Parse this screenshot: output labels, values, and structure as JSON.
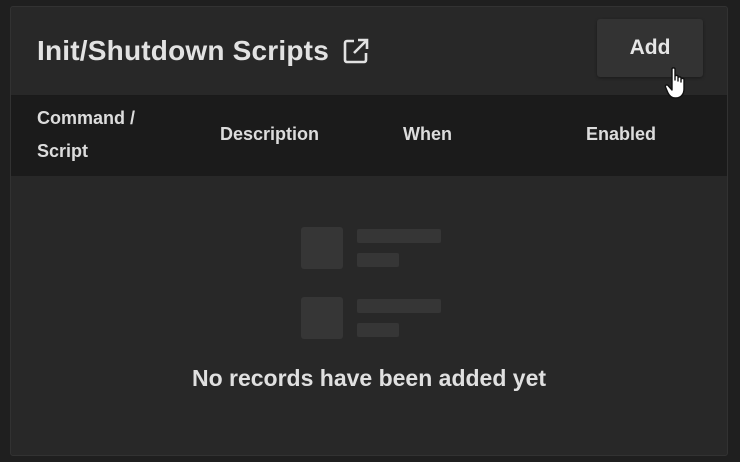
{
  "card": {
    "title": "Init/Shutdown Scripts",
    "external_link_icon": "open-in-new-icon",
    "add_label": "Add"
  },
  "table": {
    "columns": [
      "Command / Script",
      "Description",
      "When",
      "Enabled"
    ]
  },
  "empty_state": {
    "icon": "empty-list-icon",
    "message": "No records have been added yet"
  },
  "colors": {
    "background": "#1f1f1f",
    "card": "#282828",
    "header_row": "#1b1b1b",
    "text": "#e2e2e2"
  }
}
